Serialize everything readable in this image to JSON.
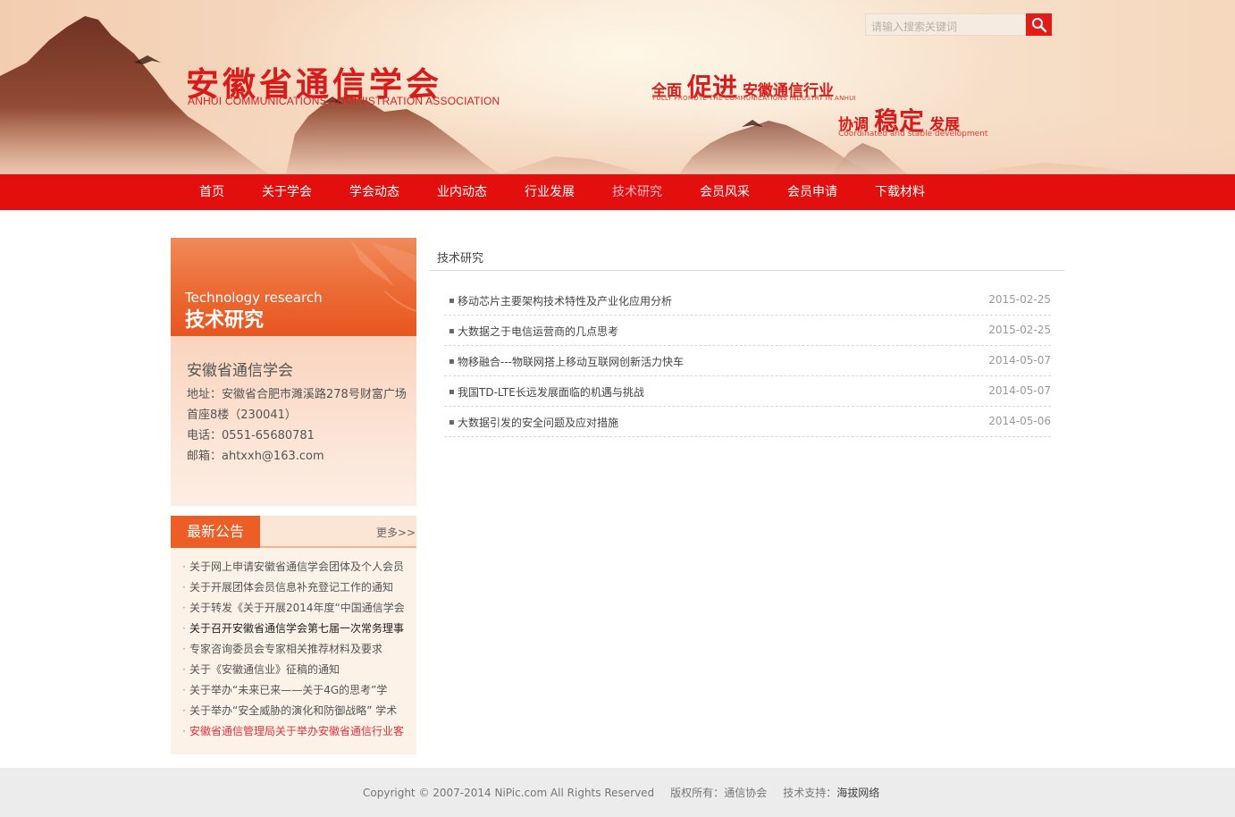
{
  "header": {
    "logo_cn": "安徽省通信学会",
    "logo_en": "ANHUI COMMUNICATIONS ADMINISTRATION ASSOCIATION",
    "slogan1_pre": "全面",
    "slogan1_big": "促进",
    "slogan1_post": "安徽通信行业",
    "slogan1_en": "FULLY PROMOTE THE COMMUNICATIONS INDUSTRY IN ANHUI",
    "slogan2_pre": "协调",
    "slogan2_big": "稳定",
    "slogan2_post": "发展",
    "slogan2_en": "Coordinated and stable development",
    "search_placeholder": "请输入搜索关键词",
    "search_icon": "search-icon"
  },
  "nav": {
    "items": [
      "首页",
      "关于学会",
      "学会动态",
      "业内动态",
      "行业发展",
      "技术研究",
      "会员风采",
      "会员申请",
      "下载材料"
    ],
    "active": "技术研究"
  },
  "sidebar": {
    "banner_en": "Technology research",
    "banner_cn": "技术研究",
    "contact": {
      "org": "安徽省通信学会",
      "address_1": "地址：安徽省合肥市濉溪路278号财富广场",
      "address_2": "首座8楼（230041）",
      "phone": "电话：0551-65680781",
      "email": "邮箱：ahtxxh@163.com"
    },
    "notice": {
      "title": "最新公告",
      "more": "更多>>",
      "items": [
        "关于网上申请安徽省通信学会团体及个人会员",
        "关于开展团体会员信息补充登记工作的通知",
        "关于转发《关于开展2014年度“中国通信学会",
        "关于召开安徽省通信学会第七届一次常务理事",
        "专家咨询委员会专家相关推荐材料及要求",
        "关于《安徽通信业》征稿的通知",
        "关于举办“未来已来——关于4G的思考”学",
        "关于举办“安全威胁的演化和防御战略” 学术",
        "安徽省通信管理局关于举办安徽省通信行业客"
      ]
    }
  },
  "main": {
    "title": "技术研究",
    "articles": [
      {
        "title": "移动芯片主要架构技术特性及产业化应用分析",
        "date": "2015-02-25"
      },
      {
        "title": "大数据之于电信运营商的几点思考",
        "date": "2015-02-25"
      },
      {
        "title": "物移融合---物联网搭上移动互联网创新活力快车",
        "date": "2014-05-07"
      },
      {
        "title": "我国TD-LTE长远发展面临的机遇与挑战",
        "date": "2014-05-07"
      },
      {
        "title": "大数据引发的安全问题及应对措施",
        "date": "2014-05-06"
      }
    ]
  },
  "footer": {
    "copyright": "Copyright © 2007-2014 NiPic.com All Rights Reserved",
    "rights_label": "版权所有：",
    "rights_value": "通信协会",
    "support_label": "技术支持：",
    "support_value": "海拔网络"
  },
  "colors": {
    "nav_bg": "#e30e0e",
    "accent_orange": "#ec5e26",
    "brand_red": "#d81c1c",
    "active_nav": "#f7b8c6"
  }
}
